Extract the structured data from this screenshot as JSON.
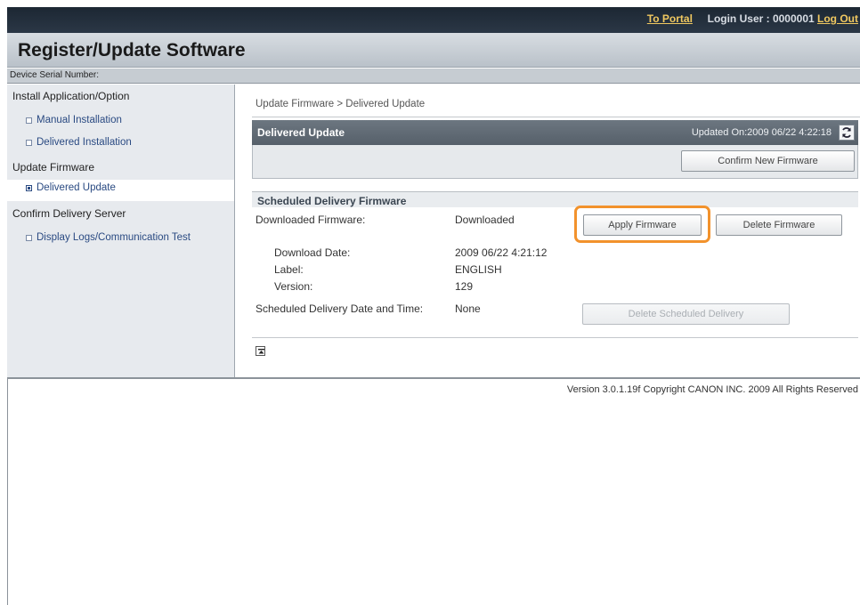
{
  "topbar": {
    "portal_link": "To Portal",
    "login_user": "Login User : 0000001",
    "logout_link": "Log Out"
  },
  "header": {
    "title": "Register/Update Software"
  },
  "serial": {
    "label": "Device Serial Number:"
  },
  "sidebar": {
    "group1": "Install Application/Option",
    "manual_installation": "Manual Installation",
    "delivered_installation": "Delivered Installation",
    "group2": "Update Firmware",
    "delivered_update": "Delivered Update",
    "group3": "Confirm Delivery Server",
    "display_logs": "Display Logs/Communication Test"
  },
  "main": {
    "breadcrumb": "Update Firmware > Delivered Update",
    "panel_title": "Delivered Update",
    "updated_on": "Updated On:2009 06/22 4:22:18",
    "confirm_button": "Confirm New Firmware",
    "scheduled_title": "Scheduled Delivery Firmware",
    "downloaded_firmware_label": "Downloaded Firmware:",
    "downloaded_firmware_value": "Downloaded",
    "apply_button": "Apply Firmware",
    "delete_button": "Delete Firmware",
    "download_date_label": "Download Date:",
    "download_date_value": "2009 06/22 4:21:12",
    "label_label": "Label:",
    "label_value": "ENGLISH",
    "version_label": "Version:",
    "version_value": "129",
    "scheduled_date_label": "Scheduled Delivery Date and Time:",
    "scheduled_date_value": "None",
    "delete_scheduled_button": "Delete Scheduled Delivery"
  },
  "footer": {
    "text": "Version 3.0.1.19f Copyright CANON INC. 2009 All Rights Reserved"
  },
  "colors": {
    "highlight": "#f2922c",
    "topbar": "#1c2733",
    "link": "#f0c860",
    "nav_text": "#2a4a82"
  },
  "icons": {
    "refresh": "refresh-icon",
    "to_top": "to-top-icon",
    "bullet": "square-bullet-icon"
  }
}
